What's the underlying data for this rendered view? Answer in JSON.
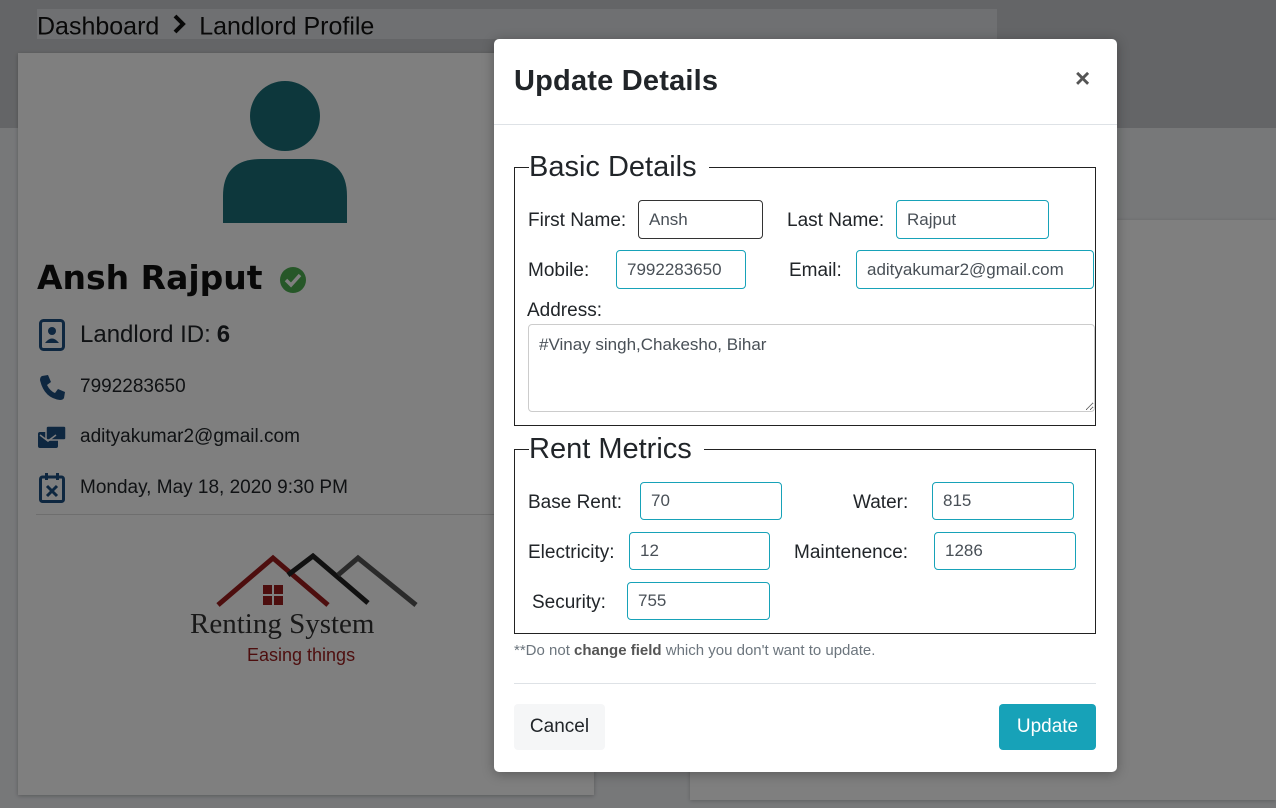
{
  "breadcrumb": {
    "item1": "Dashboard",
    "item2": "Landlord Profile"
  },
  "profile": {
    "name": "Ansh Rajput",
    "id_label": "Landlord ID:",
    "id_value": "6",
    "phone": "7992283650",
    "email": "adityakumar2@gmail.com",
    "date": "Monday, May 18, 2020 9:30 PM",
    "logo_title": "Renting System",
    "logo_tagline": "Easing things"
  },
  "modal": {
    "title": "Update Details",
    "close": "×",
    "basic_legend": "Basic Details",
    "first_name_label": "First Name:",
    "first_name_value": "Ansh",
    "last_name_label": "Last Name:",
    "last_name_value": "Rajput",
    "mobile_label": "Mobile:",
    "mobile_value": "7992283650",
    "email_label": "Email:",
    "email_value": "adityakumar2@gmail.com",
    "address_label": "Address:",
    "address_value": "#Vinay singh,Chakesho, Bihar",
    "rent_legend": "Rent Metrics",
    "base_rent_label": "Base Rent:",
    "base_rent_value": "70",
    "water_label": "Water:",
    "water_value": "815",
    "electricity_label": "Electricity:",
    "electricity_value": "12",
    "maintenance_label": "Maintenence:",
    "maintenance_value": "1286",
    "security_label": "Security:",
    "security_value": "755",
    "note_prefix": "**Do not",
    "note_bold": "change field",
    "note_suffix": "which you don't want to update.",
    "cancel_label": "Cancel",
    "update_label": "Update"
  },
  "colors": {
    "accent": "#17a2b8",
    "avatar": "#1b6f78",
    "verified": "#4caf50",
    "brand_red": "#9b1c1c"
  }
}
